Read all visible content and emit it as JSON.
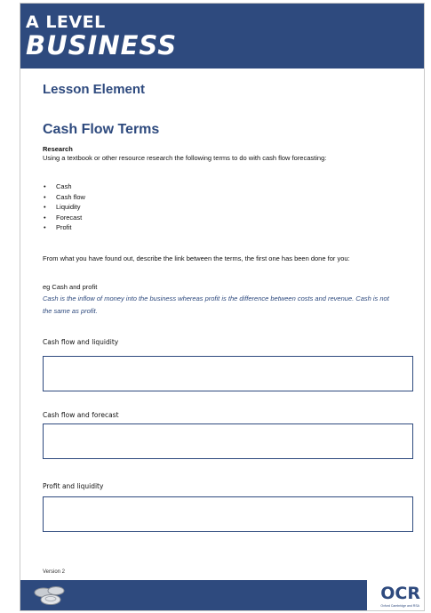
{
  "banner": {
    "line1": "A LEVEL",
    "line2": "BUSINESS"
  },
  "lesson_element": "Lesson Element",
  "title": "Cash Flow Terms",
  "research": {
    "heading": "Research",
    "instruction": "Using a textbook or other resource research the following terms to do with cash flow forecasting:"
  },
  "terms": [
    "Cash",
    "Cash flow",
    "Liquidity",
    "Forecast",
    "Profit"
  ],
  "bullet": "•",
  "describe_instruction": "From what you have found out, describe the link between the terms, the first one has been done for you:",
  "example": {
    "label": "eg Cash and profit",
    "answer": "Cash is the inflow of money into the business whereas profit is the difference between costs and revenue.  Cash is not the same as profit."
  },
  "fields": [
    {
      "label": "Cash flow and liquidity"
    },
    {
      "label": "Cash flow and forecast"
    },
    {
      "label": "Profit and liquidity"
    }
  ],
  "version": "Version 2",
  "footer": {
    "logo_text": "OCR",
    "logo_subtext": "Oxford Cambridge and RSA",
    "coins_icon": "coins-icon"
  },
  "colors": {
    "brand": "#2e4a7e"
  }
}
